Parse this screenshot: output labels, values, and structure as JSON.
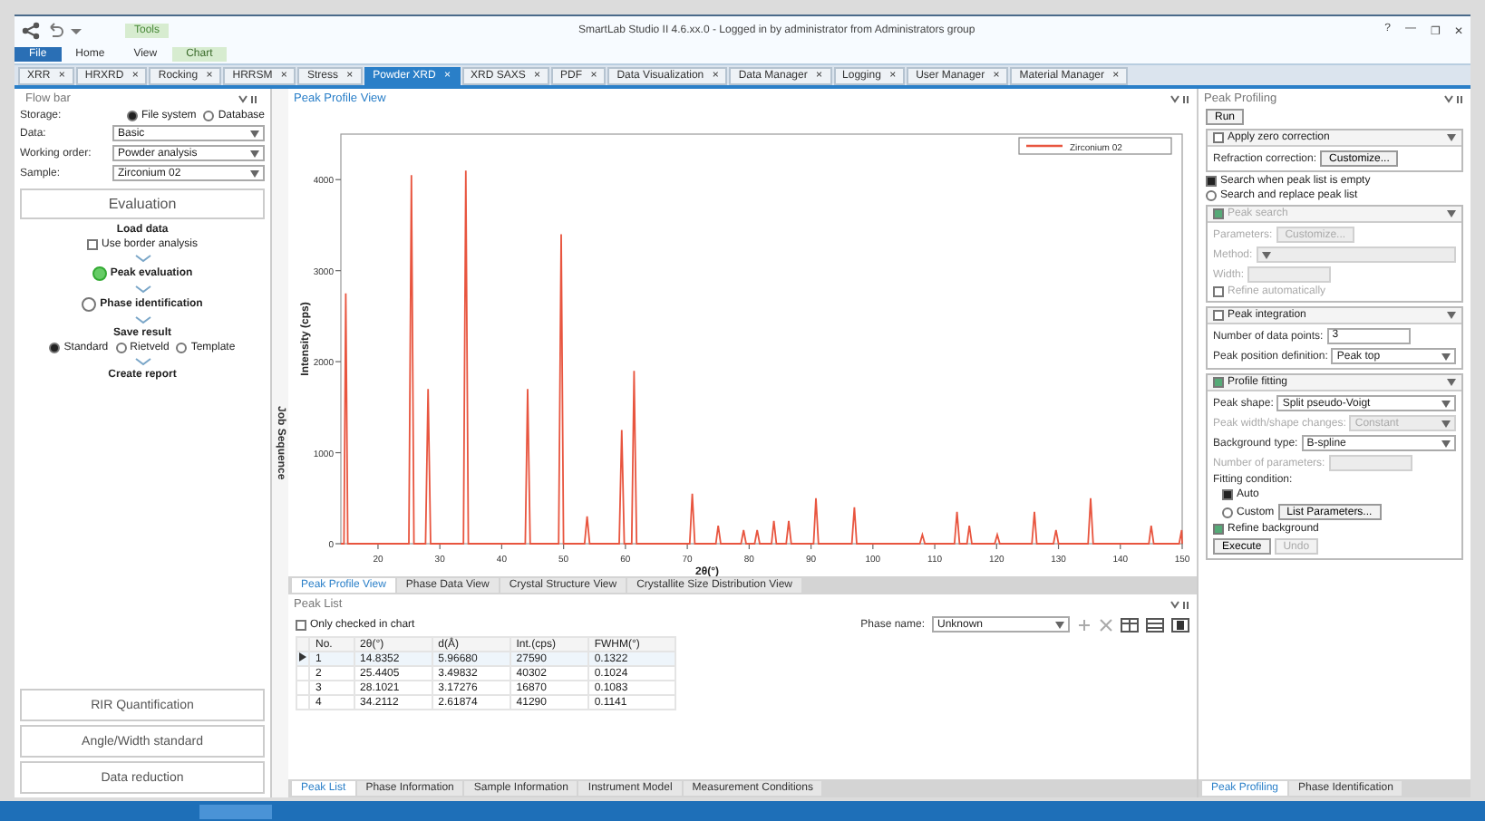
{
  "window": {
    "title": "SmartLab Studio II 4.6.xx.0 - Logged in by administrator from Administrators group",
    "controls": [
      "?",
      "—",
      "❐",
      "✕"
    ]
  },
  "ribbon": {
    "context_label": "Tools",
    "tabs": [
      {
        "label": "File",
        "kind": "file"
      },
      {
        "label": "Home",
        "kind": "tab"
      },
      {
        "label": "View",
        "kind": "tab"
      },
      {
        "label": "Chart",
        "kind": "context"
      }
    ]
  },
  "doc_tabs": [
    {
      "label": "XRR",
      "close": "×",
      "selected": false
    },
    {
      "label": "HRXRD",
      "close": "×",
      "selected": false
    },
    {
      "label": "Rocking",
      "close": "×",
      "selected": false
    },
    {
      "label": "HRRSM",
      "close": "×",
      "selected": false
    },
    {
      "label": "Stress",
      "close": "×",
      "selected": false
    },
    {
      "label": "Powder XRD",
      "close": "×",
      "selected": true
    },
    {
      "label": "XRD SAXS",
      "close": "×",
      "selected": false
    },
    {
      "label": "PDF",
      "close": "×",
      "selected": false
    },
    {
      "label": "Data Visualization",
      "close": "×",
      "selected": false
    },
    {
      "label": "Data Manager",
      "close": "×",
      "selected": false
    },
    {
      "label": "Logging",
      "close": "×",
      "selected": false
    },
    {
      "label": "User Manager",
      "close": "×",
      "selected": false
    },
    {
      "label": "Material Manager",
      "close": "×",
      "selected": false
    }
  ],
  "flow_bar": {
    "title": "Flow bar",
    "storage_label": "Storage:",
    "storage_options": [
      {
        "label": "File system",
        "selected": true
      },
      {
        "label": "Database",
        "selected": false
      }
    ],
    "fields": [
      {
        "label": "Data:",
        "value": "Basic"
      },
      {
        "label": "Working order:",
        "value": "Powder analysis"
      },
      {
        "label": "Sample:",
        "value": "Zirconium 02"
      }
    ],
    "section": "Evaluation",
    "steps": [
      {
        "kind": "title",
        "label": "Load data"
      },
      {
        "kind": "checkbox",
        "label": "Use border analysis",
        "checked": false
      },
      {
        "kind": "arrow"
      },
      {
        "kind": "status",
        "label": "Peak evaluation",
        "done": true
      },
      {
        "kind": "arrow"
      },
      {
        "kind": "status",
        "label": "Phase identification",
        "done": false
      },
      {
        "kind": "arrow"
      },
      {
        "kind": "title",
        "label": "Save result"
      },
      {
        "kind": "radios",
        "options": [
          {
            "label": "Standard",
            "selected": true
          },
          {
            "label": "Rietveld",
            "selected": false
          },
          {
            "label": "Template",
            "selected": false
          }
        ]
      },
      {
        "kind": "arrow"
      },
      {
        "kind": "title",
        "label": "Create report"
      }
    ],
    "bottom_buttons": [
      "RIR Quantification",
      "Angle/Width standard",
      "Data reduction"
    ]
  },
  "side_strip": {
    "label": "Job Sequence"
  },
  "chart_panel": {
    "title": "Peak Profile View",
    "chart_data": {
      "type": "line",
      "ylabel": "Intensity (cps)",
      "xlabel": "2θ(°)",
      "xlim": [
        14,
        150
      ],
      "ylim": [
        0,
        4500
      ],
      "xticks": [
        20,
        30,
        40,
        50,
        60,
        70,
        80,
        90,
        100,
        110,
        120,
        130,
        140,
        150
      ],
      "yticks": [
        0,
        1000,
        2000,
        3000,
        4000
      ],
      "x": [
        14,
        14.5,
        14.8,
        15.1,
        25.0,
        25.4,
        25.8,
        27.7,
        28.1,
        28.5,
        33.8,
        34.2,
        34.6,
        43.8,
        44.2,
        44.6,
        49.2,
        49.6,
        50.0,
        53.4,
        53.8,
        54.2,
        59.0,
        59.4,
        59.8,
        61.0,
        61.4,
        61.8,
        70.4,
        70.8,
        71.2,
        74.6,
        75.0,
        75.4,
        78.7,
        79.1,
        79.5,
        80.9,
        81.3,
        81.7,
        83.6,
        84.0,
        84.4,
        86.0,
        86.4,
        86.8,
        90.4,
        90.8,
        91.2,
        96.6,
        97.0,
        97.4,
        107.6,
        108.0,
        108.4,
        113.2,
        113.6,
        114.0,
        115.2,
        115.6,
        116.0,
        119.7,
        120.1,
        120.5,
        125.7,
        126.1,
        126.5,
        129.2,
        129.6,
        130.0,
        134.8,
        135.2,
        135.6,
        144.6,
        145.0,
        145.4,
        149.5,
        149.9,
        150
      ],
      "series": [
        {
          "name": "Zirconium 02",
          "color": "#e8553f",
          "values": [
            0,
            0,
            2750,
            0,
            0,
            4050,
            0,
            0,
            1700,
            0,
            0,
            4100,
            0,
            0,
            1700,
            0,
            0,
            3400,
            0,
            0,
            300,
            0,
            0,
            1250,
            0,
            0,
            1900,
            0,
            0,
            550,
            0,
            0,
            200,
            0,
            0,
            150,
            0,
            0,
            150,
            0,
            0,
            250,
            0,
            0,
            250,
            0,
            0,
            500,
            0,
            0,
            400,
            0,
            0,
            100,
            0,
            0,
            350,
            0,
            0,
            200,
            0,
            0,
            100,
            0,
            0,
            350,
            0,
            0,
            150,
            0,
            0,
            500,
            0,
            0,
            200,
            0,
            0,
            150,
            0
          ]
        }
      ]
    },
    "tabs": [
      {
        "label": "Peak Profile View",
        "selected": true
      },
      {
        "label": "Phase Data View",
        "selected": false
      },
      {
        "label": "Crystal Structure View",
        "selected": false
      },
      {
        "label": "Crystallite Size Distribution View",
        "selected": false
      }
    ]
  },
  "peak_list": {
    "title": "Peak List",
    "show_checked": {
      "label": "Only checked in chart",
      "checked": false
    },
    "phase_label": "Phase name:",
    "phase_value": "Unknown",
    "columns": [
      "No.",
      "2θ(°)",
      "d(Å)",
      "Int.(cps)",
      "FWHM(°)"
    ],
    "rows": [
      {
        "selected": true,
        "cells": [
          "1",
          "14.8352",
          "5.96680",
          "27590",
          "0.1322"
        ]
      },
      {
        "selected": false,
        "cells": [
          "2",
          "25.4405",
          "3.49832",
          "40302",
          "0.1024"
        ]
      },
      {
        "selected": false,
        "cells": [
          "3",
          "28.1021",
          "3.17276",
          "16870",
          "0.1083"
        ]
      },
      {
        "selected": false,
        "cells": [
          "4",
          "34.2112",
          "2.61874",
          "41290",
          "0.1141"
        ]
      }
    ],
    "tabs": [
      {
        "label": "Peak List",
        "selected": true
      },
      {
        "label": "Phase Information",
        "selected": false
      },
      {
        "label": "Sample Information",
        "selected": false
      },
      {
        "label": "Instrument Model",
        "selected": false
      },
      {
        "label": "Measurement Conditions",
        "selected": false
      }
    ]
  },
  "profiling": {
    "title": "Peak Profiling",
    "run": "Run",
    "zero": {
      "label": "Apply zero correction",
      "checked": false,
      "refraction_label": "Refraction correction:",
      "customize": "Customize..."
    },
    "search_options": [
      {
        "label": "Search when peak list is empty",
        "selected": true
      },
      {
        "label": "Search and replace peak list",
        "selected": false
      }
    ],
    "peak_search": {
      "label": "Peak search",
      "checked": true,
      "disabled": true,
      "rows": [
        {
          "kind": "button",
          "label": "Parameters:",
          "value": "Customize...",
          "disabled": true
        },
        {
          "kind": "select",
          "label": "Method:",
          "value": "",
          "disabled": true
        },
        {
          "kind": "input",
          "label": "Width:",
          "value": "",
          "disabled": true
        }
      ],
      "refine_label": "Refine automatically"
    },
    "integration": {
      "label": "Peak integration",
      "checked": false,
      "rows": [
        {
          "kind": "input",
          "label": "Number of data points:",
          "value": "3",
          "disabled": false
        },
        {
          "kind": "select",
          "label": "Peak position definition:",
          "value": "Peak top",
          "disabled": false
        }
      ]
    },
    "fitting": {
      "label": "Profile fitting",
      "checked": true,
      "rows": [
        {
          "kind": "select",
          "label": "Peak shape:",
          "value": "Split pseudo-Voigt",
          "disabled": false
        },
        {
          "kind": "select",
          "label": "Peak width/shape changes:",
          "value": "Constant",
          "disabled": true
        },
        {
          "kind": "select",
          "label": "Background type:",
          "value": "B-spline",
          "disabled": false
        },
        {
          "kind": "input",
          "label": "Number of parameters:",
          "value": "",
          "disabled": true
        }
      ],
      "condition_label": "Fitting condition:",
      "conditions": [
        {
          "label": "Auto",
          "selected": true
        },
        {
          "label": "Custom",
          "selected": false
        }
      ],
      "list_button": "List Parameters...",
      "refine_bg": {
        "label": "Refine background",
        "checked": true
      },
      "execute": "Execute",
      "undo": {
        "label": "Undo",
        "disabled": true
      }
    },
    "tabs": [
      {
        "label": "Peak Profiling",
        "selected": true
      },
      {
        "label": "Phase Identification",
        "selected": false
      }
    ]
  }
}
